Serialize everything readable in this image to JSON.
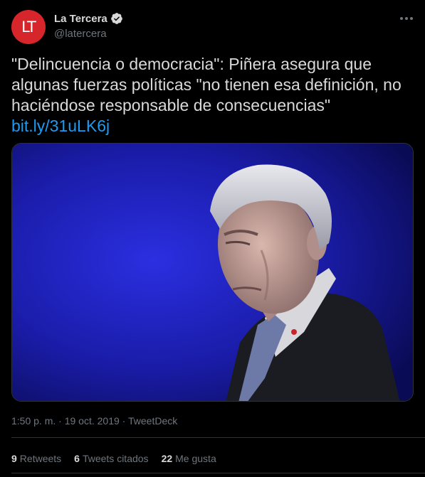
{
  "author": {
    "avatar_text": "LT",
    "display_name": "La Tercera",
    "handle": "@latercera",
    "verified": true
  },
  "tweet": {
    "text": "\"Delincuencia o democracia\": Piñera asegura que algunas fuerzas políticas \"no tienen esa definición, no haciéndose responsable de consecuencias\"",
    "link": "bit.ly/31uLK6j"
  },
  "media": {
    "type": "photo"
  },
  "meta": {
    "time": "1:50 p. m.",
    "separator1": " · ",
    "date": "19 oct. 2019",
    "separator2": " · ",
    "source": "TweetDeck"
  },
  "stats": {
    "retweets": {
      "count": "9",
      "label": "Retweets"
    },
    "quotes": {
      "count": "6",
      "label": "Tweets citados"
    },
    "likes": {
      "count": "22",
      "label": "Me gusta"
    }
  },
  "colors": {
    "background": "#000000",
    "text": "#d9d9d9",
    "secondary": "#6e767d",
    "link": "#1d9bf0",
    "avatar": "#d7262b",
    "divider": "#2f3336"
  },
  "icons": [
    "verified-badge-icon",
    "more-options-icon"
  ]
}
